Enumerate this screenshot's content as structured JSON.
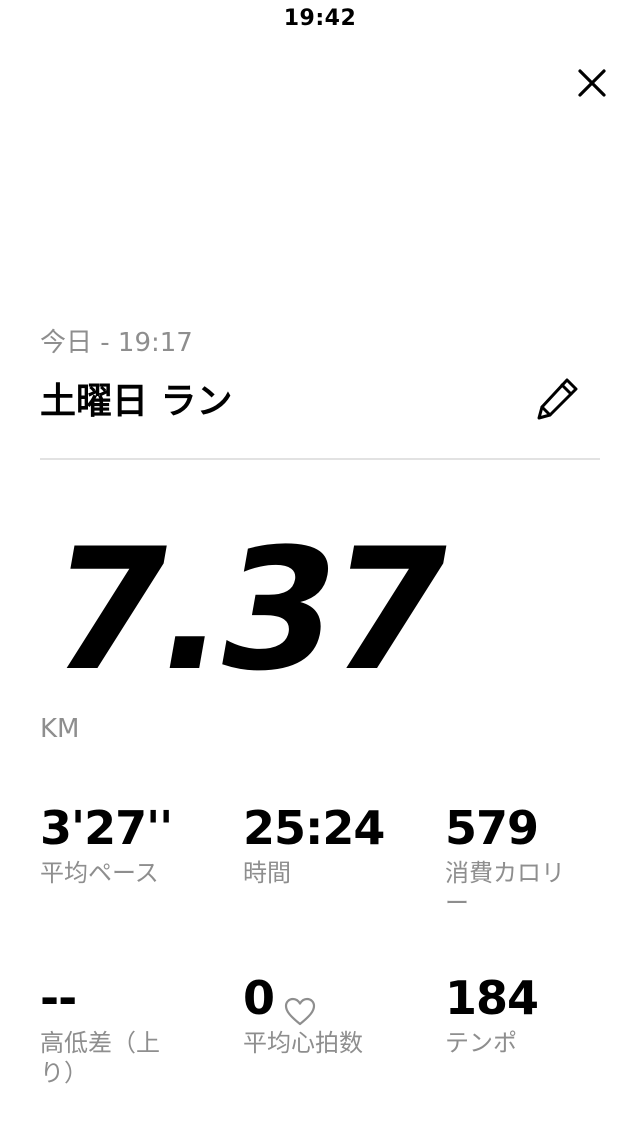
{
  "status_bar": {
    "time": "19:42"
  },
  "header": {
    "close_icon": "close-icon"
  },
  "activity": {
    "date_time": "今日 - 19:17",
    "title": "土曜日 ラン",
    "edit_icon": "pencil-icon"
  },
  "summary": {
    "distance": "7.37",
    "distance_unit": "KM"
  },
  "stats": [
    {
      "value": "3'27''",
      "label": "平均ペース"
    },
    {
      "value": "25:24",
      "label": "時間"
    },
    {
      "value": "579",
      "label": "消費カロリー"
    },
    {
      "value": "--",
      "label": "高低差（上り）"
    },
    {
      "value": "0",
      "label": "平均心拍数",
      "icon": "heart-icon"
    },
    {
      "value": "184",
      "label": "テンポ"
    }
  ]
}
